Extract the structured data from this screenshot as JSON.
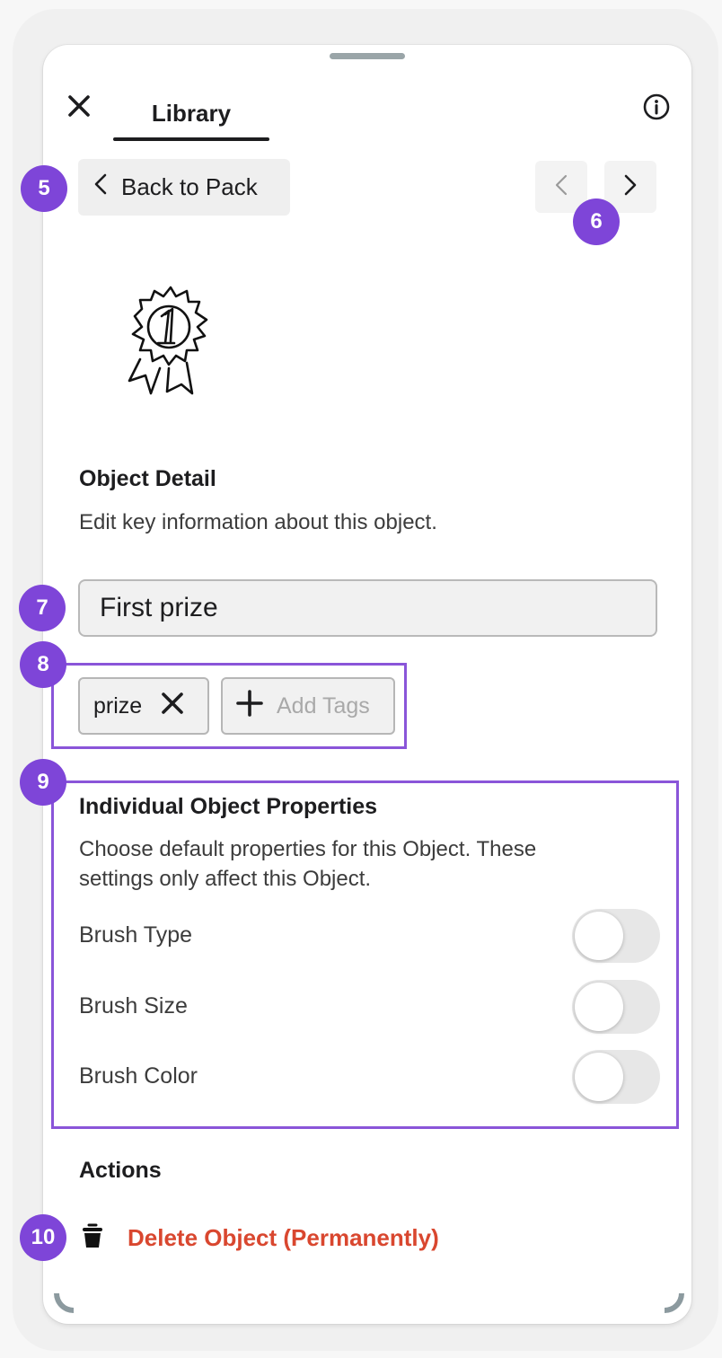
{
  "header": {
    "tab_label": "Library",
    "close_icon": "close-icon",
    "info_icon": "info-icon"
  },
  "navigation": {
    "back_label": "Back to Pack",
    "prev_icon": "chevron-left-icon",
    "next_icon": "chevron-right-icon"
  },
  "object": {
    "image": "first-prize-ribbon-icon"
  },
  "detail": {
    "title": "Object Detail",
    "description": "Edit key information about this object.",
    "name_value": "First prize"
  },
  "tags": {
    "items": [
      "prize"
    ],
    "add_label": "Add Tags"
  },
  "properties": {
    "title": "Individual Object Properties",
    "description_line1": "Choose default properties for this Object. These",
    "description_line2": "settings only affect this Object.",
    "items": [
      {
        "label": "Brush Type",
        "enabled": false
      },
      {
        "label": "Brush Size",
        "enabled": false
      },
      {
        "label": "Brush Color",
        "enabled": false
      }
    ]
  },
  "actions": {
    "title": "Actions",
    "delete_label": "Delete Object (Permanently)",
    "delete_icon": "trash-icon"
  },
  "annotations": {
    "badges": [
      "5",
      "6",
      "7",
      "8",
      "9",
      "10"
    ],
    "highlight_color": "#8a55d9",
    "badge_color": "#7e45d8"
  },
  "colors": {
    "danger": "#d9472f",
    "toggle_off": "#e7e7e7"
  }
}
